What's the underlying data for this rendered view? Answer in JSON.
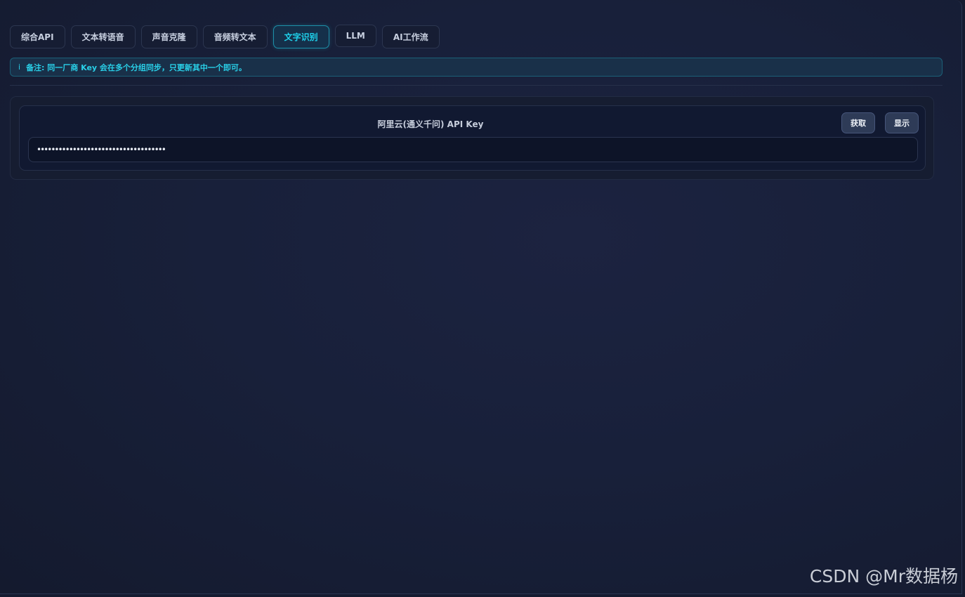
{
  "tabs": [
    {
      "label": "综合API"
    },
    {
      "label": "文本转语音"
    },
    {
      "label": "声音克隆"
    },
    {
      "label": "音频转文本"
    },
    {
      "label": "文字识别"
    },
    {
      "label": "LLM"
    },
    {
      "label": "AI工作流"
    }
  ],
  "active_tab": "文字识别",
  "notice": {
    "icon": "i",
    "text": "备注: 同一厂商 Key 会在多个分组同步，只更新其中一个即可。"
  },
  "api_key_card": {
    "title": "阿里云(通义千问) API Key",
    "fetch_label": "获取",
    "show_label": "显示",
    "masked_value": "••••••••••••••••••••••••••••••••••••"
  },
  "watermark": "CSDN @Mr数据杨",
  "colors": {
    "background": "#18203a",
    "accent": "#1fd2ec",
    "button": "#2e3b57"
  }
}
